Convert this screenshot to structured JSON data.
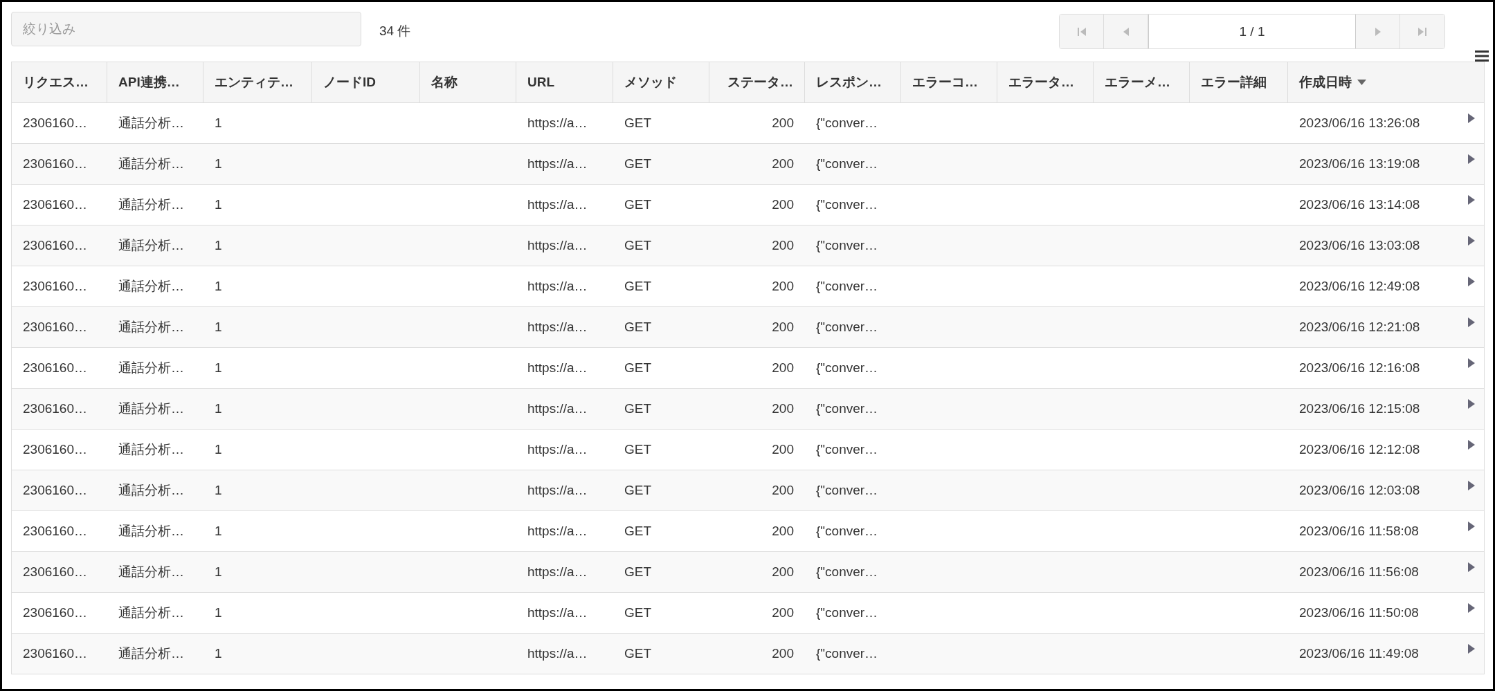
{
  "filter": {
    "placeholder": "絞り込み"
  },
  "count": "34 件",
  "pager": {
    "page": "1 / 1",
    "buttons": [
      {
        "kind": "first",
        "disabled": true
      },
      {
        "kind": "prev",
        "disabled": true
      },
      {
        "kind": "next",
        "disabled": true
      },
      {
        "kind": "last",
        "disabled": true
      }
    ]
  },
  "table": {
    "columns": [
      {
        "label": "リクエス…",
        "right_aligned": false,
        "sorted": false
      },
      {
        "label": "API連携…",
        "right_aligned": false,
        "sorted": false
      },
      {
        "label": "エンティテ…",
        "right_aligned": false,
        "sorted": false
      },
      {
        "label": "ノードID",
        "right_aligned": false,
        "sorted": false
      },
      {
        "label": "名称",
        "right_aligned": false,
        "sorted": false
      },
      {
        "label": "URL",
        "right_aligned": false,
        "sorted": false
      },
      {
        "label": "メソッド",
        "right_aligned": false,
        "sorted": false
      },
      {
        "label": "ステータ…",
        "right_aligned": true,
        "sorted": false
      },
      {
        "label": "レスポン…",
        "right_aligned": false,
        "sorted": false
      },
      {
        "label": "エラーコ…",
        "right_aligned": false,
        "sorted": false
      },
      {
        "label": "エラータ…",
        "right_aligned": false,
        "sorted": false
      },
      {
        "label": "エラーメ…",
        "right_aligned": false,
        "sorted": false
      },
      {
        "label": "エラー詳細",
        "right_aligned": false,
        "sorted": false
      },
      {
        "label": "作成日時",
        "right_aligned": false,
        "sorted": true
      }
    ],
    "rows": [
      {
        "expanded": false,
        "cells": {
          "0": "2306160…",
          "1": "通話分析…",
          "2": "1",
          "5": "https://a…",
          "6": "GET",
          "7": "200",
          "8": "{\"conver…",
          "13": "2023/06/16 13:26:08"
        }
      },
      {
        "expanded": false,
        "cells": {
          "0": "2306160…",
          "1": "通話分析…",
          "2": "1",
          "5": "https://a…",
          "6": "GET",
          "7": "200",
          "8": "{\"conver…",
          "13": "2023/06/16 13:19:08"
        }
      },
      {
        "expanded": false,
        "cells": {
          "0": "2306160…",
          "1": "通話分析…",
          "2": "1",
          "5": "https://a…",
          "6": "GET",
          "7": "200",
          "8": "{\"conver…",
          "13": "2023/06/16 13:14:08"
        }
      },
      {
        "expanded": false,
        "cells": {
          "0": "2306160…",
          "1": "通話分析…",
          "2": "1",
          "5": "https://a…",
          "6": "GET",
          "7": "200",
          "8": "{\"conver…",
          "13": "2023/06/16 13:03:08"
        }
      },
      {
        "expanded": false,
        "cells": {
          "0": "2306160…",
          "1": "通話分析…",
          "2": "1",
          "5": "https://a…",
          "6": "GET",
          "7": "200",
          "8": "{\"conver…",
          "13": "2023/06/16 12:49:08"
        }
      },
      {
        "expanded": false,
        "cells": {
          "0": "2306160…",
          "1": "通話分析…",
          "2": "1",
          "5": "https://a…",
          "6": "GET",
          "7": "200",
          "8": "{\"conver…",
          "13": "2023/06/16 12:21:08"
        }
      },
      {
        "expanded": false,
        "cells": {
          "0": "2306160…",
          "1": "通話分析…",
          "2": "1",
          "5": "https://a…",
          "6": "GET",
          "7": "200",
          "8": "{\"conver…",
          "13": "2023/06/16 12:16:08"
        }
      },
      {
        "expanded": false,
        "cells": {
          "0": "2306160…",
          "1": "通話分析…",
          "2": "1",
          "5": "https://a…",
          "6": "GET",
          "7": "200",
          "8": "{\"conver…",
          "13": "2023/06/16 12:15:08"
        }
      },
      {
        "expanded": false,
        "cells": {
          "0": "2306160…",
          "1": "通話分析…",
          "2": "1",
          "5": "https://a…",
          "6": "GET",
          "7": "200",
          "8": "{\"conver…",
          "13": "2023/06/16 12:12:08"
        }
      },
      {
        "expanded": false,
        "cells": {
          "0": "2306160…",
          "1": "通話分析…",
          "2": "1",
          "5": "https://a…",
          "6": "GET",
          "7": "200",
          "8": "{\"conver…",
          "13": "2023/06/16 12:03:08"
        }
      },
      {
        "expanded": false,
        "cells": {
          "0": "2306160…",
          "1": "通話分析…",
          "2": "1",
          "5": "https://a…",
          "6": "GET",
          "7": "200",
          "8": "{\"conver…",
          "13": "2023/06/16 11:58:08"
        }
      },
      {
        "expanded": false,
        "cells": {
          "0": "2306160…",
          "1": "通話分析…",
          "2": "1",
          "5": "https://a…",
          "6": "GET",
          "7": "200",
          "8": "{\"conver…",
          "13": "2023/06/16 11:56:08"
        }
      },
      {
        "expanded": false,
        "cells": {
          "0": "2306160…",
          "1": "通話分析…",
          "2": "1",
          "5": "https://a…",
          "6": "GET",
          "7": "200",
          "8": "{\"conver…",
          "13": "2023/06/16 11:50:08"
        }
      },
      {
        "expanded": false,
        "cells": {
          "0": "2306160…",
          "1": "通話分析…",
          "2": "1",
          "5": "https://a…",
          "6": "GET",
          "7": "200",
          "8": "{\"conver…",
          "13": "2023/06/16 11:49:08"
        }
      }
    ]
  }
}
